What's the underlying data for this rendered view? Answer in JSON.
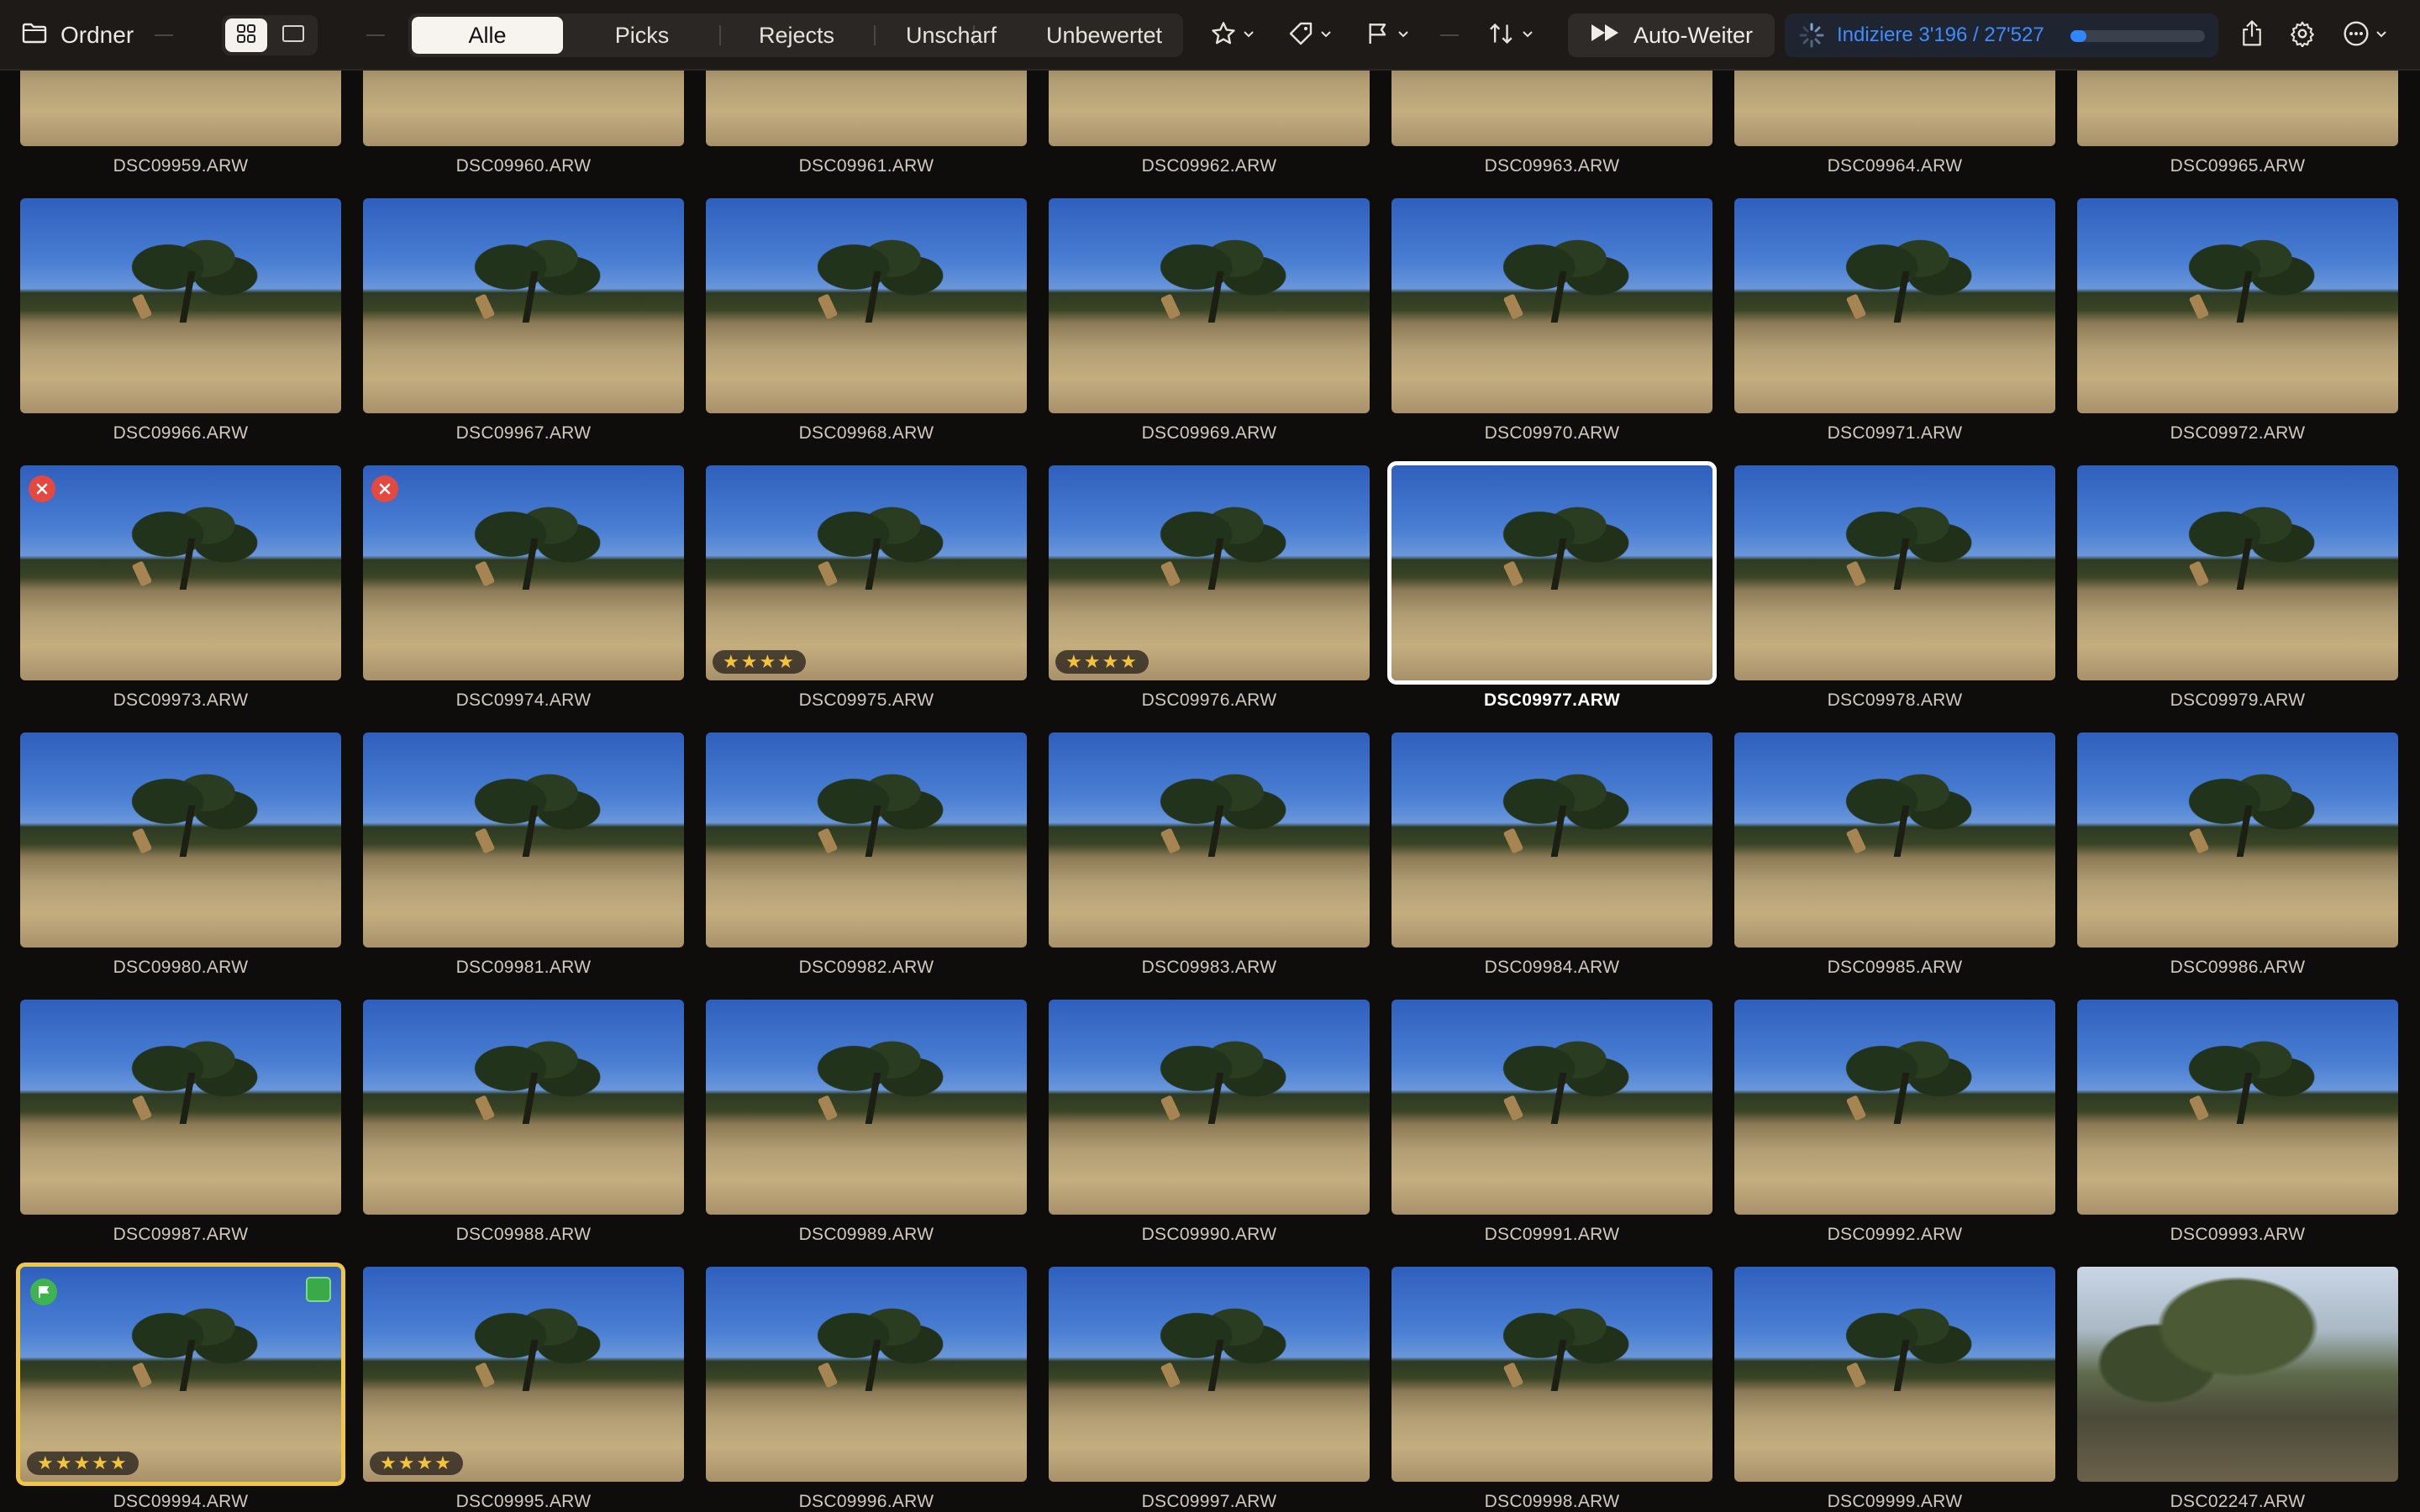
{
  "toolbar": {
    "folder_label": "Ordner",
    "filters": [
      {
        "label": "Alle",
        "active": true
      },
      {
        "label": "Picks",
        "active": false
      },
      {
        "label": "Rejects",
        "active": false
      },
      {
        "label": "Unscharf",
        "active": false
      },
      {
        "label": "Unbewertet",
        "active": false
      }
    ],
    "auto_label": "Auto-Weiter",
    "indexing_text": "Indiziere 3'196 / 27'527",
    "indexing_progress": 0.116,
    "accent_color": "#3f8cff"
  },
  "photos": [
    {
      "name": "DSC09959.ARW"
    },
    {
      "name": "DSC09960.ARW"
    },
    {
      "name": "DSC09961.ARW"
    },
    {
      "name": "DSC09962.ARW"
    },
    {
      "name": "DSC09963.ARW"
    },
    {
      "name": "DSC09964.ARW"
    },
    {
      "name": "DSC09965.ARW"
    },
    {
      "name": "DSC09966.ARW"
    },
    {
      "name": "DSC09967.ARW"
    },
    {
      "name": "DSC09968.ARW"
    },
    {
      "name": "DSC09969.ARW"
    },
    {
      "name": "DSC09970.ARW"
    },
    {
      "name": "DSC09971.ARW"
    },
    {
      "name": "DSC09972.ARW"
    },
    {
      "name": "DSC09973.ARW",
      "rejected": true
    },
    {
      "name": "DSC09974.ARW",
      "rejected": true
    },
    {
      "name": "DSC09975.ARW",
      "stars": 4
    },
    {
      "name": "DSC09976.ARW",
      "stars": 4
    },
    {
      "name": "DSC09977.ARW",
      "selected": true
    },
    {
      "name": "DSC09978.ARW"
    },
    {
      "name": "DSC09979.ARW"
    },
    {
      "name": "DSC09980.ARW"
    },
    {
      "name": "DSC09981.ARW"
    },
    {
      "name": "DSC09982.ARW"
    },
    {
      "name": "DSC09983.ARW"
    },
    {
      "name": "DSC09984.ARW"
    },
    {
      "name": "DSC09985.ARW"
    },
    {
      "name": "DSC09986.ARW"
    },
    {
      "name": "DSC09987.ARW"
    },
    {
      "name": "DSC09988.ARW"
    },
    {
      "name": "DSC09989.ARW"
    },
    {
      "name": "DSC09990.ARW"
    },
    {
      "name": "DSC09991.ARW"
    },
    {
      "name": "DSC09992.ARW"
    },
    {
      "name": "DSC09993.ARW"
    },
    {
      "name": "DSC09994.ARW",
      "stars": 5,
      "flagged": true,
      "color_label": "green",
      "picked": true
    },
    {
      "name": "DSC09995.ARW",
      "stars": 4
    },
    {
      "name": "DSC09996.ARW"
    },
    {
      "name": "DSC09997.ARW"
    },
    {
      "name": "DSC09998.ARW"
    },
    {
      "name": "DSC09999.ARW"
    },
    {
      "name": "DSC02247.ARW",
      "alt": true
    }
  ]
}
